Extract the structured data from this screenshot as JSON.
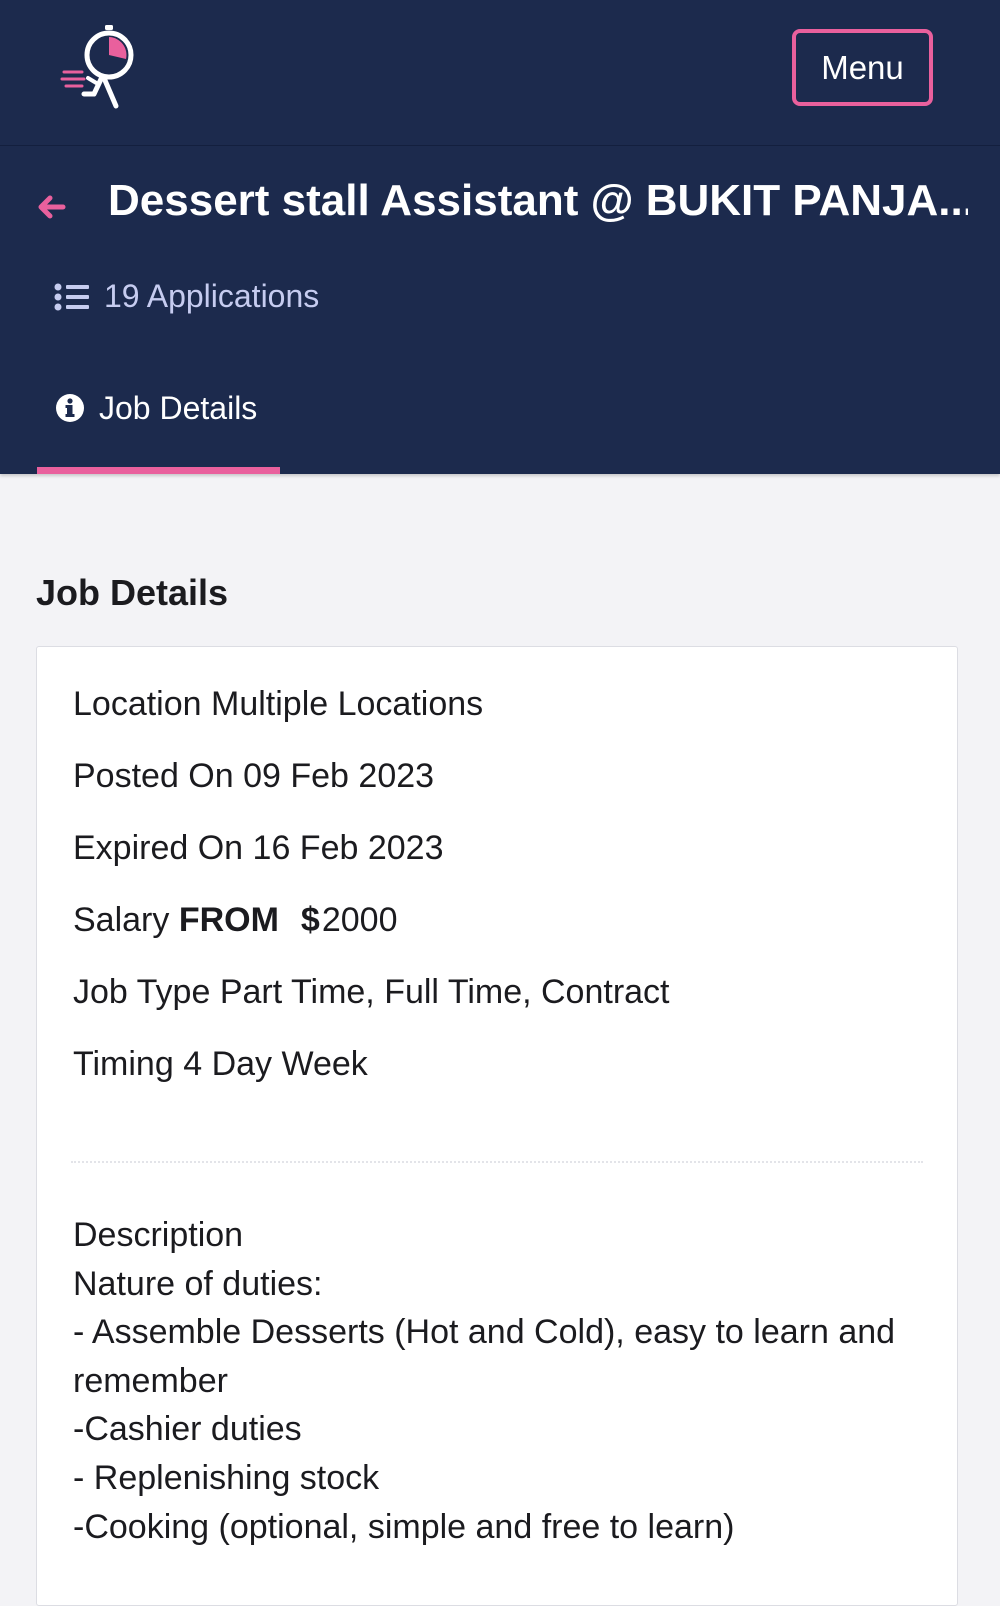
{
  "topbar": {
    "logo_icon": "running-stopwatch-logo-icon",
    "menu_label": "Menu"
  },
  "header": {
    "back_icon": "arrow-left-icon",
    "title": "Dessert stall Assistant @ BUKIT PANJA...",
    "applications_icon": "list-icon",
    "applications_label": "19 Applications",
    "tab": {
      "icon": "info-circle-icon",
      "label": "Job Details"
    }
  },
  "section_heading": "Job Details",
  "details": {
    "location_label": "Location",
    "location_value": "Multiple Locations",
    "posted_label": "Posted On",
    "posted_value": "09 Feb 2023",
    "expired_label": "Expired On",
    "expired_value": "16 Feb 2023",
    "salary_label": "Salary",
    "salary_from": "FROM",
    "salary_currency": "$",
    "salary_value": "2000",
    "job_type_label": "Job Type",
    "job_type_value": "Part Time, Full Time, Contract",
    "timing_label": "Timing",
    "timing_value": "4 Day Week"
  },
  "description": {
    "heading": "Description",
    "lines": [
      "Nature of duties:",
      "- Assemble Desserts (Hot and Cold), easy to learn and",
      "remember",
      "-Cashier duties",
      "- Replenishing stock",
      "-Cooking (optional, simple and free to learn)"
    ]
  },
  "colors": {
    "navy": "#1c2a4d",
    "accent_pink": "#e9609d",
    "page_background": "#f3f3f6",
    "muted_text": "#c6ccf0"
  }
}
